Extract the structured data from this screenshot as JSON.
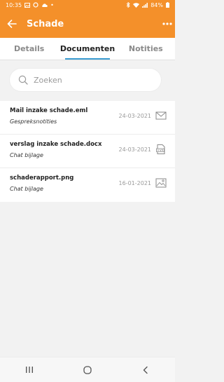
{
  "status": {
    "time": "10:35",
    "battery": "84%"
  },
  "header": {
    "title": "Schade"
  },
  "tabs": [
    {
      "label": "Details"
    },
    {
      "label": "Documenten"
    },
    {
      "label": "Notities"
    }
  ],
  "search": {
    "placeholder": "Zoeken"
  },
  "documents": [
    {
      "title": "Mail inzake schade.eml",
      "subtitle": "Gespreksnotities",
      "date": "24-03-2021",
      "icon": "mail-icon"
    },
    {
      "title": "verslag inzake schade.docx",
      "subtitle": "Chat bijlage",
      "date": "24-03-2021",
      "icon": "docx-file-icon"
    },
    {
      "title": "schaderapport.png",
      "subtitle": "Chat bijlage",
      "date": "16-01-2021",
      "icon": "image-icon"
    }
  ],
  "colors": {
    "accent": "#f4902a",
    "tab_indicator": "#3a9bd1"
  }
}
